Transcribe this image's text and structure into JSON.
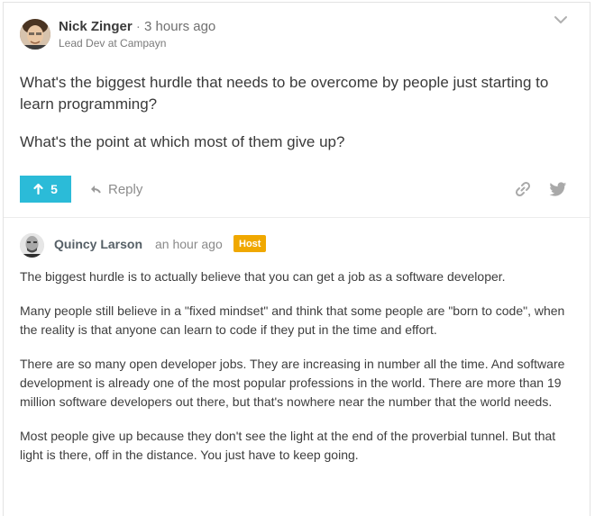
{
  "question": {
    "author_name": "Nick Zinger",
    "separator": "·",
    "time": "3 hours ago",
    "author_role": "Lead Dev at Campayn",
    "paragraphs": [
      "What's the biggest hurdle that needs to be overcome by people just starting to learn programming?",
      "What's the point at which most of them give up?"
    ],
    "upvotes": "5",
    "reply_label": "Reply"
  },
  "answer": {
    "author_name": "Quincy Larson",
    "time": "an hour ago",
    "badge": "Host",
    "paragraphs": [
      "The biggest hurdle is to actually believe that you can get a job as a software developer.",
      "Many people still believe in a \"fixed mindset\" and think that some people are \"born to code\", when the reality is that anyone can learn to code if they put in the time and effort.",
      "There are so many open developer jobs. They are increasing in number all the time. And software development is already one of the most popular professions in the world. There are more than 19 million software developers out there, but that's nowhere near the number that the world needs.",
      "Most people give up because they don't see the light at the end of the proverbial tunnel. But that light is there, off in the distance. You just have to keep going."
    ]
  },
  "icons": {
    "chevron": "chevron-down-icon",
    "upvote": "arrow-up-icon",
    "reply": "reply-arrow-icon",
    "link": "link-icon",
    "share": "twitter-icon"
  },
  "colors": {
    "accent": "#2bbbd8",
    "host_badge": "#f0a800",
    "muted": "#8d8d8d"
  }
}
